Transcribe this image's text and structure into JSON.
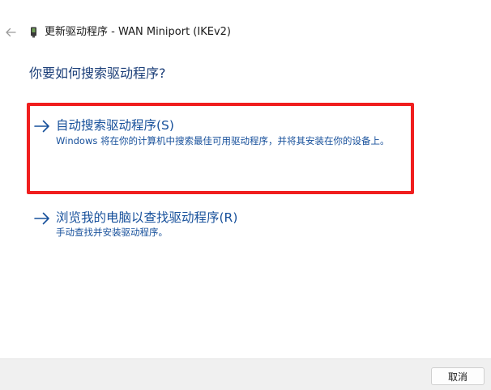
{
  "header": {
    "title": "更新驱动程序 - WAN Miniport (IKEv2)"
  },
  "main": {
    "question": "你要如何搜索驱动程序?",
    "options": [
      {
        "title": "自动搜索驱动程序(S)",
        "description": "Windows 将在你的计算机中搜索最佳可用驱动程序，并将其安装在你的设备上。"
      },
      {
        "title": "浏览我的电脑以查找驱动程序(R)",
        "description": "手动查找并安装驱动程序。"
      }
    ]
  },
  "footer": {
    "cancel_label": "取消"
  },
  "icons": {
    "back": "back-arrow-icon",
    "device": "device-icon",
    "option_arrow": "arrow-right-icon"
  },
  "colors": {
    "link_blue": "#17509b",
    "question_blue": "#1b3e78",
    "highlight_red": "#f01e1e",
    "footer_bg": "#f0f0f0"
  }
}
